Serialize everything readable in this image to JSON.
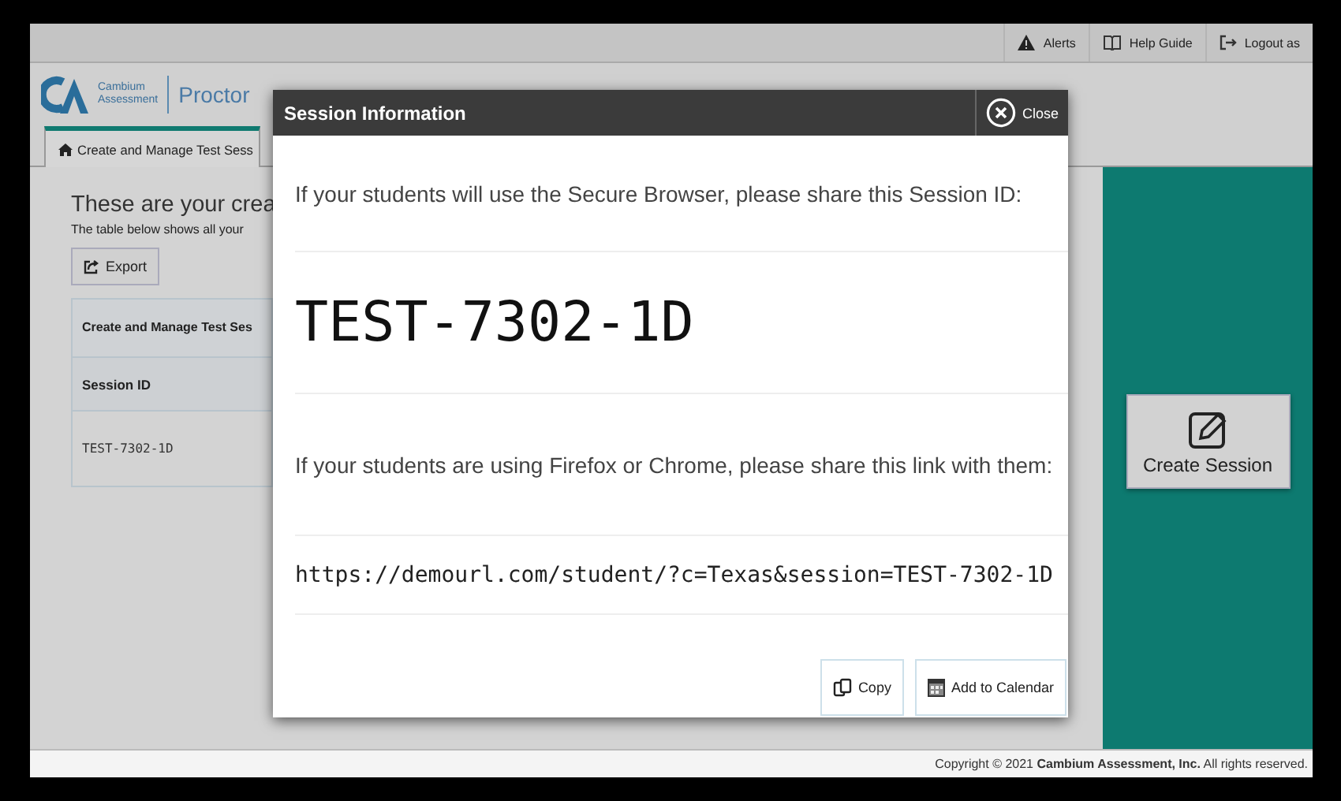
{
  "top_bar": {
    "links": [
      {
        "kind": "alert",
        "label": "Alerts"
      },
      {
        "kind": "guide",
        "label": "Help Guide"
      },
      {
        "kind": "logout",
        "label": "Logout as"
      }
    ]
  },
  "header": {
    "logo_lines": [
      "Cambium",
      "Assessment"
    ],
    "app_title": "Proctor"
  },
  "tabs": [
    {
      "label": "Create and Manage Test Sess",
      "selected": true
    }
  ],
  "main": {
    "heading": "These are your crea",
    "description": "The table below shows all your",
    "export_button": "Export",
    "table": {
      "caption": "Create and Manage Test Ses",
      "columns": [
        "Session ID"
      ],
      "rows": [
        [
          "TEST-7302-1D"
        ]
      ]
    }
  },
  "side_panel": {
    "create_button": "Create Session"
  },
  "dialog": {
    "title": "Session Information",
    "close_button": "Close",
    "secure_prompt": "If your students will use the Secure Browser, please share this Session ID:",
    "session_id": "TEST-7302-1D",
    "link_prompt": "If your students are using Firefox or Chrome, please share this link with them:",
    "link": "https://demourl.com/student/?c=Texas&session=TEST-7302-1D",
    "buttons": [
      {
        "kind": "copy",
        "label": "Copy"
      },
      {
        "kind": "calendar",
        "label": "Add to Calendar"
      }
    ]
  },
  "footer": {
    "copyright": "Copyright © 2021 **Cambium Assessment, Inc.** All rights reserved."
  }
}
